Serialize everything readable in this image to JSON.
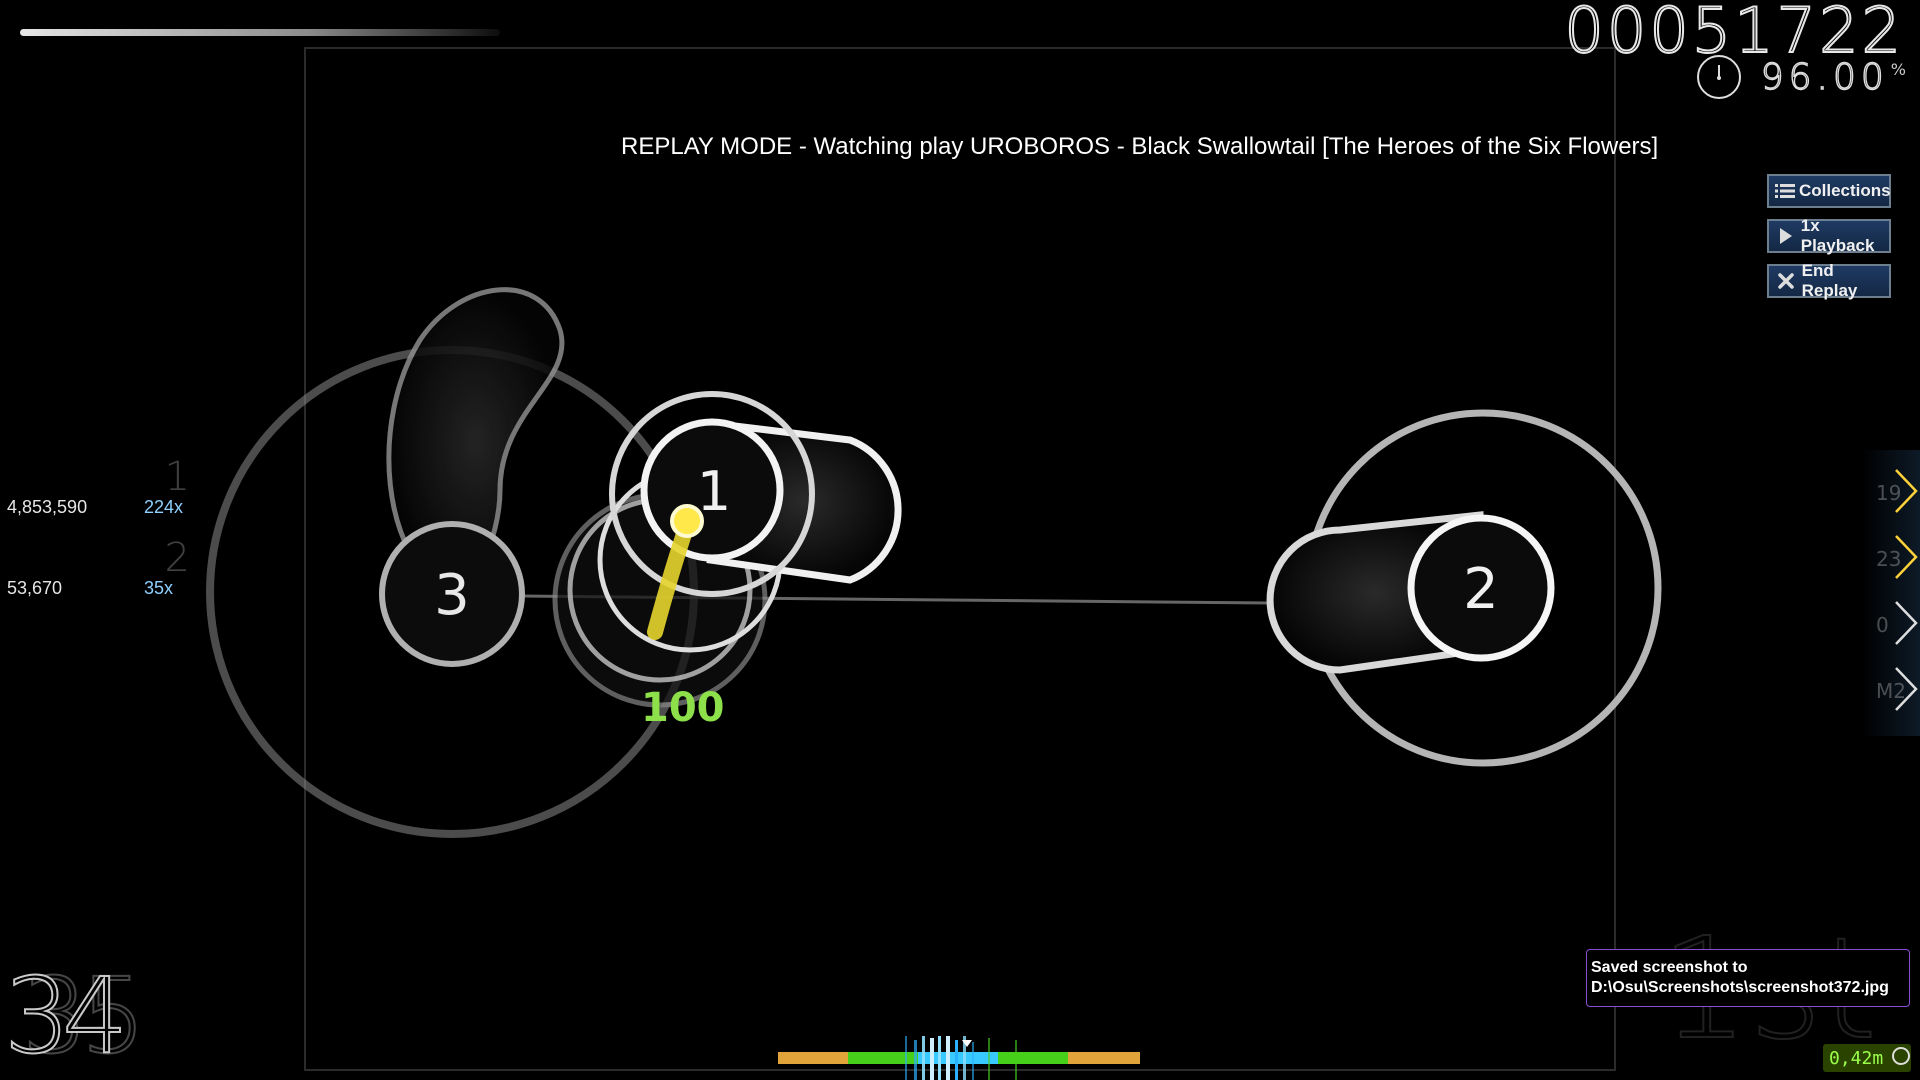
{
  "hud": {
    "score": "00051722",
    "accuracy": "96.00",
    "accuracy_unit": "%",
    "combo": "34",
    "combo_ghost": "35",
    "rank_ghost": "1st"
  },
  "banner": {
    "text": "REPLAY MODE - Watching  play UROBOROS - Black Swallowtail [The Heroes of the Six Flowers]"
  },
  "buttons": {
    "collections": "Collections",
    "playback": "1x Playback",
    "end_replay": "End Replay"
  },
  "leaderboard": [
    {
      "rank": "1",
      "score": "4,853,590",
      "combo": "224x"
    },
    {
      "rank": "2",
      "score": "53,670",
      "combo": "35x"
    }
  ],
  "keys": [
    {
      "label": "19"
    },
    {
      "label": "23"
    },
    {
      "label": "0"
    },
    {
      "label": "M2"
    }
  ],
  "playfield": {
    "circle_numbers": [
      "1",
      "2",
      "3"
    ],
    "judgement": "100"
  },
  "notification": {
    "line1": "Saved screenshot to",
    "line2": "D:\\Osu\\Screenshots\\screenshot372.jpg"
  },
  "fps": "0,42m",
  "colors": {
    "accent_yellow": "#ffe84a",
    "hit_green": "#8ee04a",
    "bar_orange": "#e0a43a",
    "bar_green": "#46d01a",
    "bar_cyan": "#38c9ff",
    "button_border": "#6d7f8f"
  }
}
